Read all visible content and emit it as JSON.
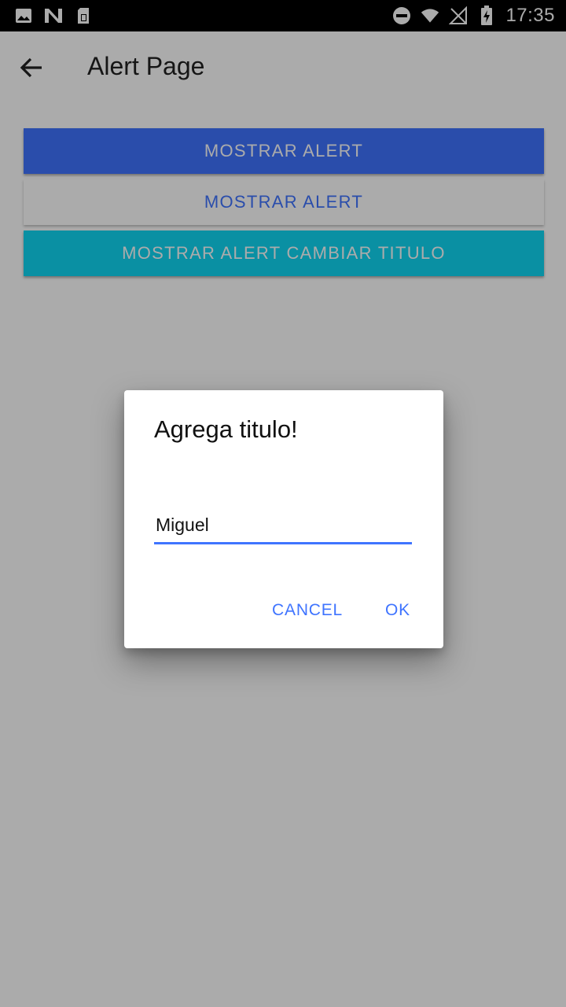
{
  "status_bar": {
    "time": "17:35",
    "left_icons": [
      "image-icon",
      "n-notification-icon",
      "sim-card-icon"
    ],
    "right_icons": [
      "do-not-disturb-icon",
      "wifi-icon",
      "no-signal-icon",
      "battery-charging-icon"
    ]
  },
  "app_bar": {
    "title": "Alert Page",
    "back_icon": "arrow-back-icon"
  },
  "buttons": {
    "show_alert_1": "MOSTRAR ALERT",
    "show_alert_2": "MOSTRAR ALERT",
    "show_alert_change_title": "MOSTRAR ALERT CAMBIAR TITULO"
  },
  "dialog": {
    "title": "Agrega titulo!",
    "input_value": "Miguel",
    "cancel_label": "CANCEL",
    "ok_label": "OK"
  },
  "colors": {
    "primary": "#3f74ff",
    "accent": "#10d7f4",
    "scrim": "rgba(0,0,0,0.33)"
  }
}
